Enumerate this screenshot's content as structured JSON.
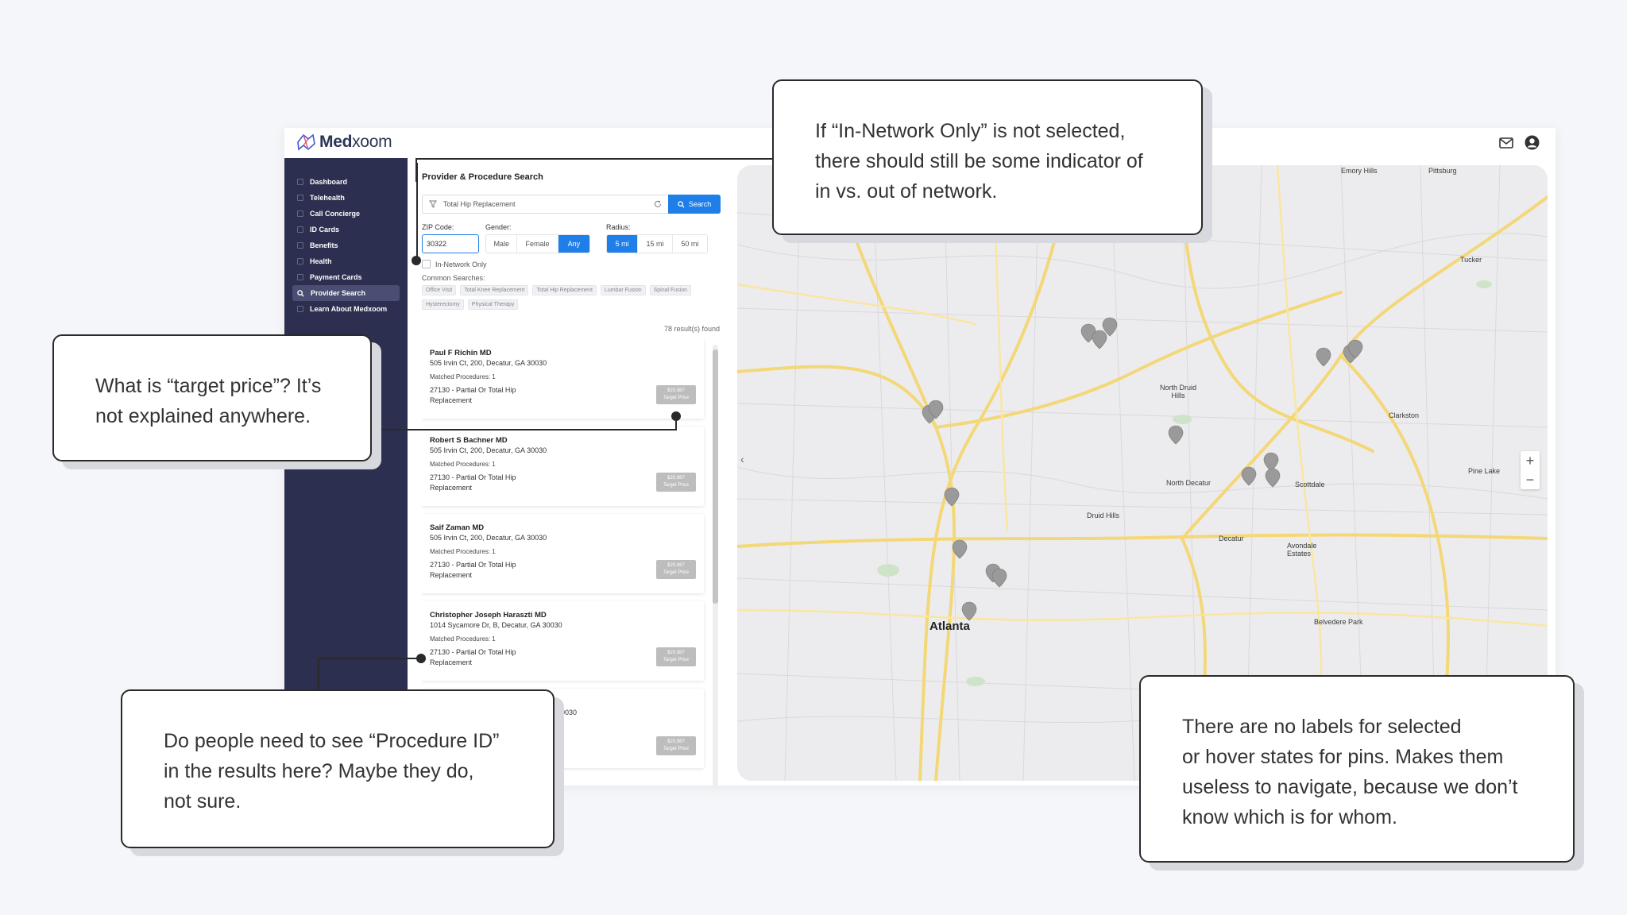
{
  "app": {
    "logo_text_bold": "Med",
    "logo_text_light": "xoom"
  },
  "sidebar": {
    "items": [
      {
        "label": "Dashboard",
        "icon": "grid-icon"
      },
      {
        "label": "Telehealth",
        "icon": "video-icon"
      },
      {
        "label": "Call Concierge",
        "icon": "phone-icon"
      },
      {
        "label": "ID Cards",
        "icon": "id-card-icon"
      },
      {
        "label": "Benefits",
        "icon": "heart-icon"
      },
      {
        "label": "Health",
        "icon": "document-icon"
      },
      {
        "label": "Payment Cards",
        "icon": "card-icon"
      },
      {
        "label": "Provider Search",
        "icon": "search-icon",
        "active": true
      },
      {
        "label": "Learn About Medxoom",
        "icon": "info-icon"
      }
    ]
  },
  "search": {
    "title": "Provider & Procedure Search",
    "query": "Total Hip Replacement",
    "button": "Search",
    "zip_label": "ZIP Code:",
    "zip_value": "30322",
    "gender_label": "Gender:",
    "gender_options": [
      "Male",
      "Female",
      "Any"
    ],
    "gender_selected": "Any",
    "radius_label": "Radius:",
    "radius_options": [
      "5 mi",
      "15 mi",
      "50 mi"
    ],
    "radius_selected": "5 mi",
    "in_network_label": "In-Network Only",
    "common_label": "Common Searches:",
    "common_searches": [
      "Office Visit",
      "Total Knee Replacement",
      "Total Hip Replacement",
      "Lumbar Fusion",
      "Spinal Fusion",
      "Hysterectomy",
      "Physical Therapy"
    ],
    "results_count": "78 result(s) found"
  },
  "results": [
    {
      "name": "Paul F Richin MD",
      "address": "505 Irvin Ct, 200, Decatur, GA 30030",
      "matched": "Matched Procedures: 1",
      "procedure": "27130 - Partial Or Total Hip Replacement",
      "price": "$20,987",
      "price_label": "Target Price"
    },
    {
      "name": "Robert S Bachner MD",
      "address": "505 Irvin Ct, 200, Decatur, GA 30030",
      "matched": "Matched Procedures: 1",
      "procedure": "27130 - Partial Or Total Hip Replacement",
      "price": "$20,987",
      "price_label": "Target Price"
    },
    {
      "name": "Saif Zaman MD",
      "address": "505 Irvin Ct, 200, Decatur, GA 30030",
      "matched": "Matched Procedures: 1",
      "procedure": "27130 - Partial Or Total Hip Replacement",
      "price": "$20,987",
      "price_label": "Target Price"
    },
    {
      "name": "Christopher Joseph Haraszti MD",
      "address": "1014 Sycamore Dr, B, Decatur, GA 30030",
      "matched": "Matched Procedures: 1",
      "procedure": "27130 - Partial Or Total Hip Replacement",
      "price": "$20,987",
      "price_label": "Target Price"
    },
    {
      "name": "",
      "address": "30030",
      "matched": "",
      "procedure": "",
      "price": "$20,987",
      "price_label": "Target Price"
    }
  ],
  "map": {
    "labels": [
      "Emory Hills",
      "Pittsburg",
      "Tucker",
      "North Druid Hills",
      "Clarkston",
      "North Decatur",
      "Scottdale",
      "Pine Lake",
      "Druid Hills",
      "Decatur",
      "Avondale Estates",
      "Atlanta",
      "Belvedere Park"
    ],
    "zoom_in": "+",
    "zoom_out": "−",
    "collapse": "‹"
  },
  "annotations": {
    "in_network": [
      "If “In-Network Only” is not selected,",
      "there should still be some indicator of",
      "in vs. out of network."
    ],
    "target_price": [
      "What is “target price”? It’s",
      "not explained anywhere."
    ],
    "procedure_id": [
      "Do people need to see “Procedure ID”",
      "in the results here? Maybe they do,",
      "not sure."
    ],
    "pins": [
      "There are no labels for selected",
      "or hover states for pins. Makes them",
      "useless to navigate, because we don’t",
      "know which is for whom."
    ]
  }
}
